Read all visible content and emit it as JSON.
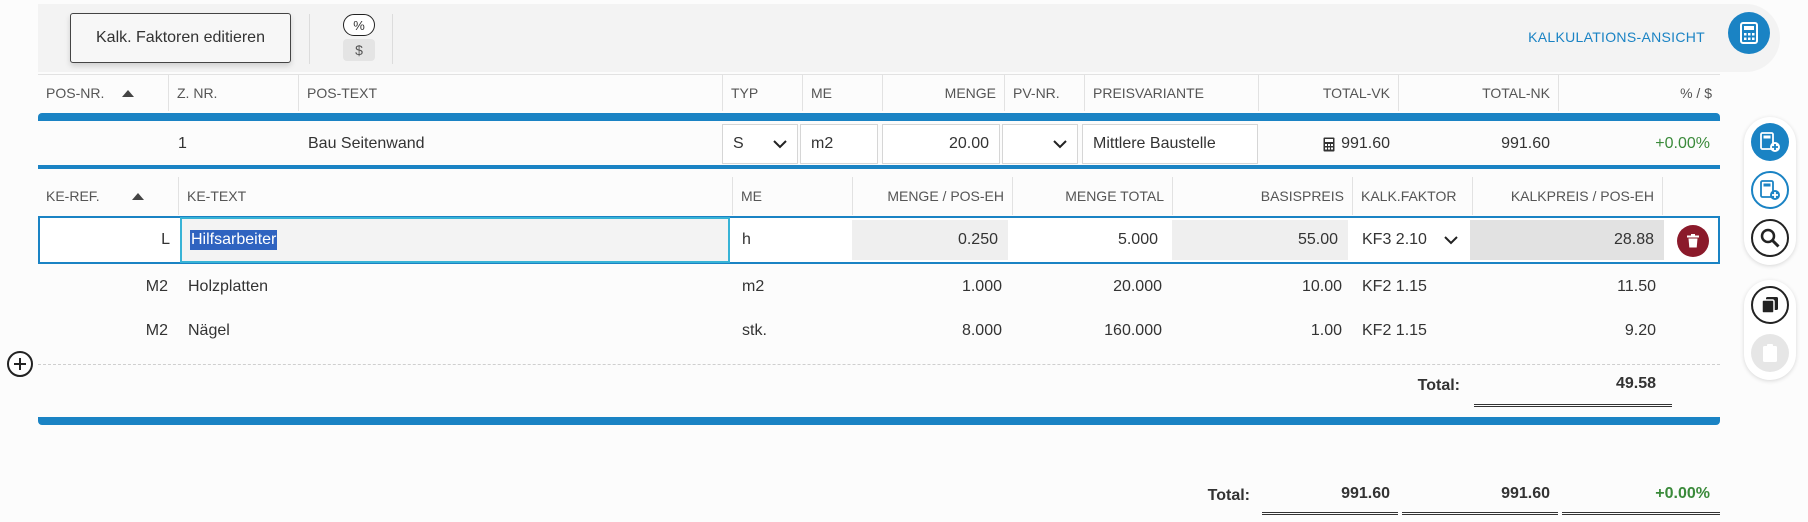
{
  "toolbar": {
    "edit_label": "Kalk. Faktoren editieren",
    "toggle_percent": "%",
    "toggle_dollar": "$",
    "view_label": "KALKULATIONS-ANSICHT"
  },
  "pos_table": {
    "headers": [
      "POS-NR.",
      "Z. NR.",
      "POS-TEXT",
      "TYP",
      "ME",
      "MENGE",
      "PV-NR.",
      "PREISVARIANTE",
      "TOTAL-VK",
      "TOTAL-NK",
      "% / $"
    ],
    "row": {
      "pos_nr": "",
      "z_nr": "1",
      "pos_text": "Bau Seitenwand",
      "typ": "S",
      "me": "m2",
      "menge": "20.00",
      "pv_nr": "",
      "preisvariante": "Mittlere Baustelle",
      "total_vk": "991.60",
      "total_nk": "991.60",
      "pct": "+0.00%"
    }
  },
  "ke_table": {
    "headers": [
      "KE-REF.",
      "KE-TEXT",
      "ME",
      "MENGE / POS-EH",
      "MENGE TOTAL",
      "BASISPREIS",
      "KALK.FAKTOR",
      "KALKPREIS / POS-EH"
    ],
    "rows": [
      {
        "ref": "L",
        "text": "Hilfsarbeiter",
        "me": "h",
        "menge_eh": "0.250",
        "menge_total": "5.000",
        "basispreis": "55.00",
        "faktor": "KF3 2.10",
        "kalkpreis": "28.88"
      },
      {
        "ref": "M2",
        "text": "Holzplatten",
        "me": "m2",
        "menge_eh": "1.000",
        "menge_total": "20.000",
        "basispreis": "10.00",
        "faktor": "KF2 1.15",
        "kalkpreis": "11.50"
      },
      {
        "ref": "M2",
        "text": "Nägel",
        "me": "stk.",
        "menge_eh": "8.000",
        "menge_total": "160.000",
        "basispreis": "1.00",
        "faktor": "KF2 1.15",
        "kalkpreis": "9.20"
      }
    ],
    "total_label": "Total:",
    "total_value": "49.58"
  },
  "grand_total": {
    "label": "Total:",
    "vk": "991.60",
    "nk": "991.60",
    "pct": "+0.00%"
  },
  "colors": {
    "accent": "#1a83c4",
    "delete": "#8b1a2b",
    "positive": "#3a8a3a"
  },
  "icons": {
    "calculator": "calculator-icon",
    "add_calc": "calculator-plus-icon",
    "search": "magnifier-icon",
    "copy": "copy-icon",
    "paste": "clipboard-icon",
    "delete": "trash-icon",
    "add": "plus-circle-icon"
  }
}
